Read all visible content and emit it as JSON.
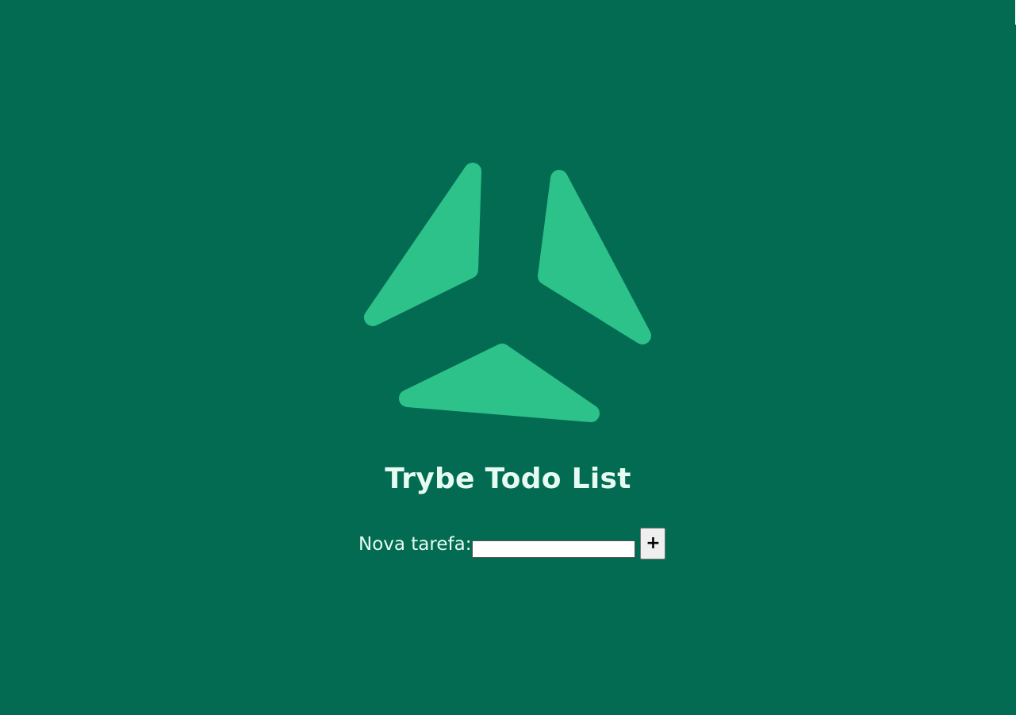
{
  "app": {
    "title": "Trybe Todo List"
  },
  "logo": {
    "icon": "trybe-logo-icon",
    "color": "#2cc28a"
  },
  "form": {
    "label": "Nova tarefa:",
    "input_value": "",
    "input_placeholder": "",
    "add_button_label": "+"
  },
  "colors": {
    "background": "#036b52",
    "title_text": "#e6fcf2",
    "logo_accent": "#2cc28a"
  }
}
